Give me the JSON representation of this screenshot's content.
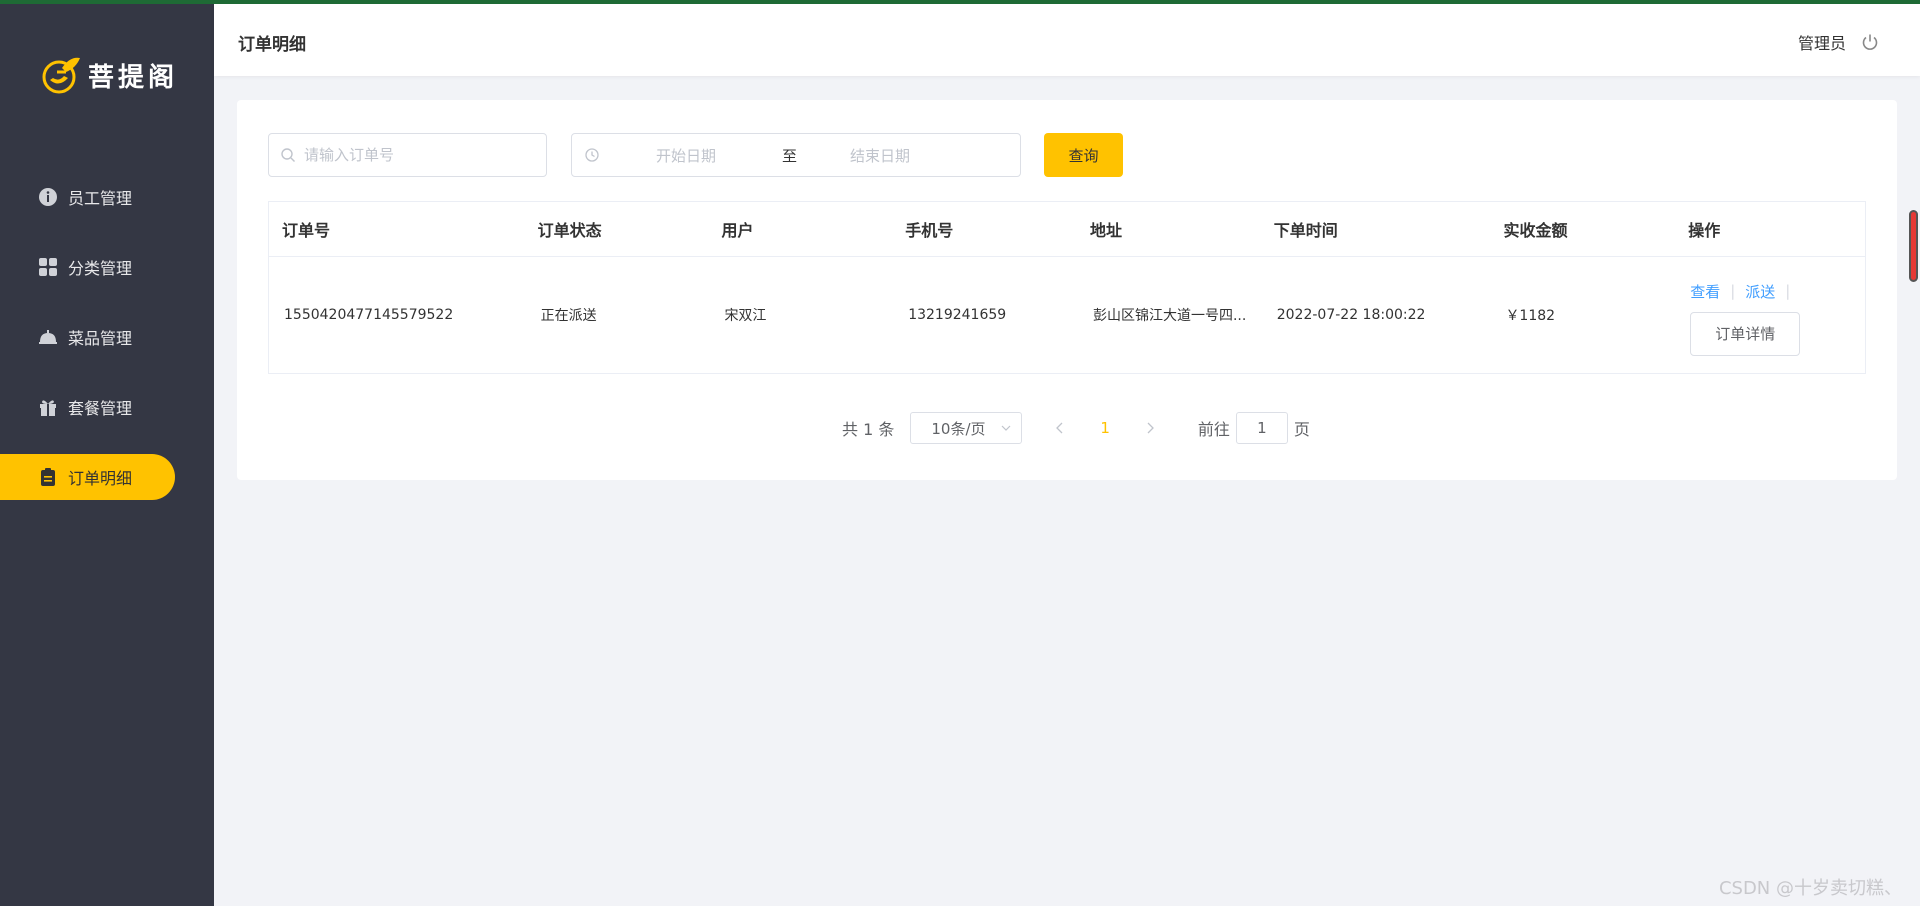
{
  "app": {
    "logo_text": "菩提阁"
  },
  "sidebar": {
    "items": [
      {
        "label": "员工管理",
        "icon": "info-icon"
      },
      {
        "label": "分类管理",
        "icon": "grid-icon"
      },
      {
        "label": "菜品管理",
        "icon": "dish-icon"
      },
      {
        "label": "套餐管理",
        "icon": "gift-icon"
      },
      {
        "label": "订单明细",
        "icon": "clipboard-icon",
        "active": true
      }
    ]
  },
  "header": {
    "title": "订单明细",
    "user": "管理员",
    "logout_icon": "power-icon"
  },
  "filters": {
    "order_placeholder": "请输入订单号",
    "start_placeholder": "开始日期",
    "separator": "至",
    "end_placeholder": "结束日期",
    "query_label": "查询"
  },
  "table": {
    "columns": [
      "订单号",
      "订单状态",
      "用户",
      "手机号",
      "地址",
      "下单时间",
      "实收金额",
      "操作"
    ],
    "rows": [
      {
        "order_no": "1550420477145579522",
        "status": "正在派送",
        "user": "宋双江",
        "phone": "13219241659",
        "address": "彭山区锦江大道一号四...",
        "time": "2022-07-22 18:00:22",
        "amount": "￥1182",
        "view": "查看",
        "dispatch": "派送",
        "detail": "订单详情"
      }
    ]
  },
  "pagination": {
    "total_text": "共 1 条",
    "page_size": "10条/页",
    "current": "1",
    "goto_prefix": "前往",
    "goto_value": "1",
    "goto_suffix": "页"
  },
  "watermark": "CSDN @十岁卖切糕、",
  "colors": {
    "sidebar_bg": "#343744",
    "accent": "#ffc200",
    "link": "#409eff",
    "page_bg": "#f2f3f7"
  }
}
